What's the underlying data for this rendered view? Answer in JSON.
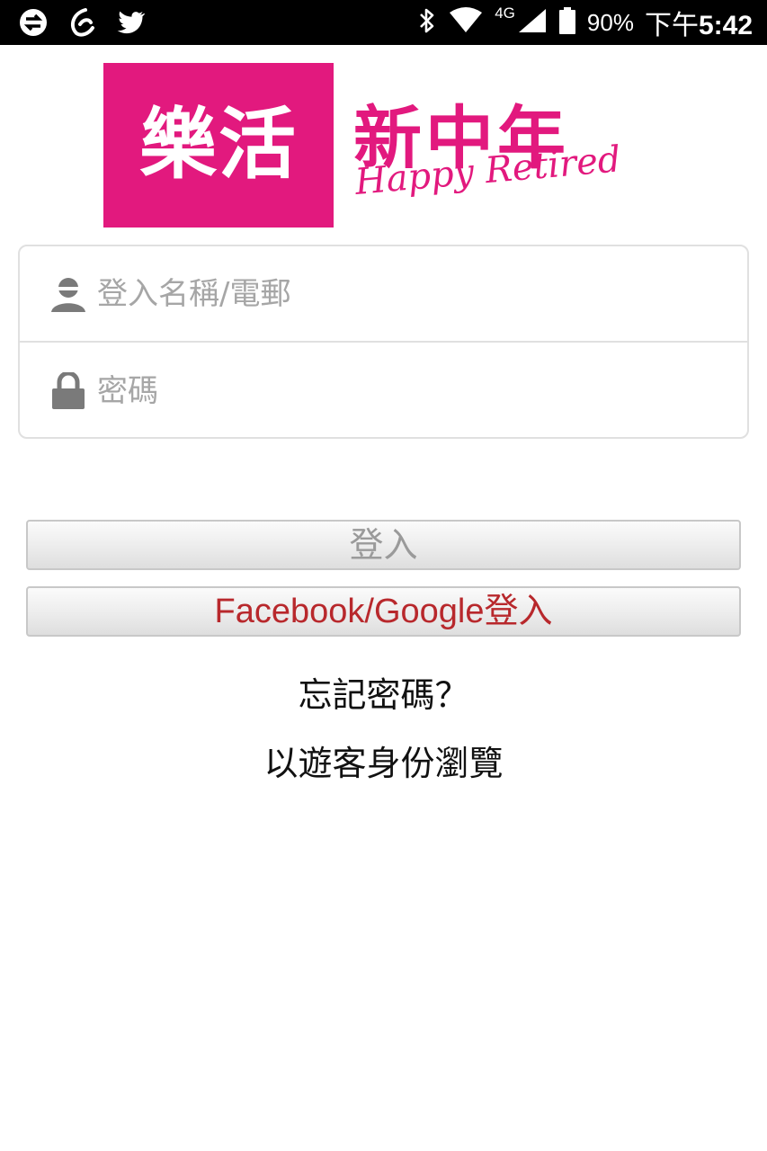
{
  "status_bar": {
    "left_icons": [
      "sync-icon",
      "swirl-app-icon",
      "twitter-icon"
    ],
    "right_icons": [
      "bluetooth-icon",
      "wifi-icon",
      "signal-icon",
      "battery-icon"
    ],
    "network_type": "4G",
    "battery_percent": "90%",
    "time_prefix": "下午",
    "time": "5:42"
  },
  "logo": {
    "box_text": "樂活",
    "title": "新中年",
    "subtitle": "Happy Retired",
    "brand_color": "#e2197e"
  },
  "login_form": {
    "username_placeholder": "登入名稱/電郵",
    "password_placeholder": "密碼",
    "username_value": "",
    "password_value": ""
  },
  "buttons": {
    "login_label": "登入",
    "social_login_label": "Facebook/Google登入",
    "social_login_color": "#b8282c"
  },
  "links": {
    "forgot_password": "忘記密碼？",
    "guest_browse": "以遊客身份瀏覽"
  }
}
